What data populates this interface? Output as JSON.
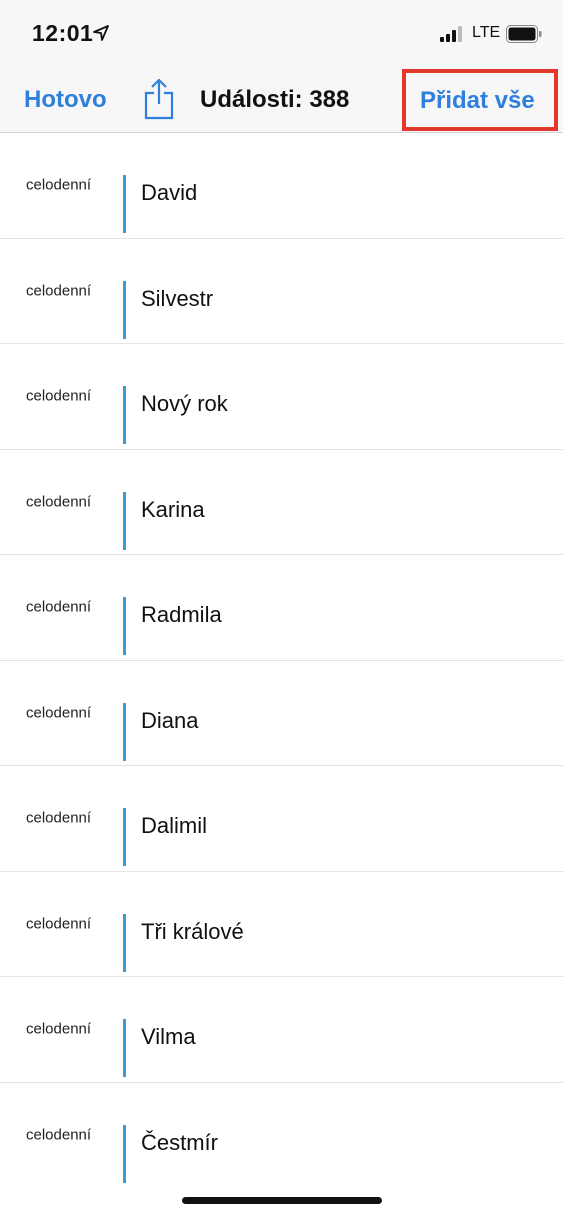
{
  "status_bar": {
    "time": "12:01",
    "network": "LTE",
    "icons": [
      "location-arrow-icon",
      "signal-bars-icon",
      "battery-icon"
    ]
  },
  "navbar": {
    "done_label": "Hotovo",
    "share_icon": "share-icon",
    "title": "Události: 388",
    "add_all_label": "Přidat vše"
  },
  "events": [
    {
      "time": "celodenní",
      "title": "David"
    },
    {
      "time": "celodenní",
      "title": "Silvestr"
    },
    {
      "time": "celodenní",
      "title": "Nový rok"
    },
    {
      "time": "celodenní",
      "title": "Karina"
    },
    {
      "time": "celodenní",
      "title": "Radmila"
    },
    {
      "time": "celodenní",
      "title": "Diana"
    },
    {
      "time": "celodenní",
      "title": "Dalimil"
    },
    {
      "time": "celodenní",
      "title": "Tři králové"
    },
    {
      "time": "celodenní",
      "title": "Vilma"
    },
    {
      "time": "celodenní",
      "title": "Čestmír"
    }
  ],
  "colors": {
    "accent": "#2f7fdc",
    "highlight_box": "#e2382b",
    "calendar_bar": "#3a9bd6"
  }
}
